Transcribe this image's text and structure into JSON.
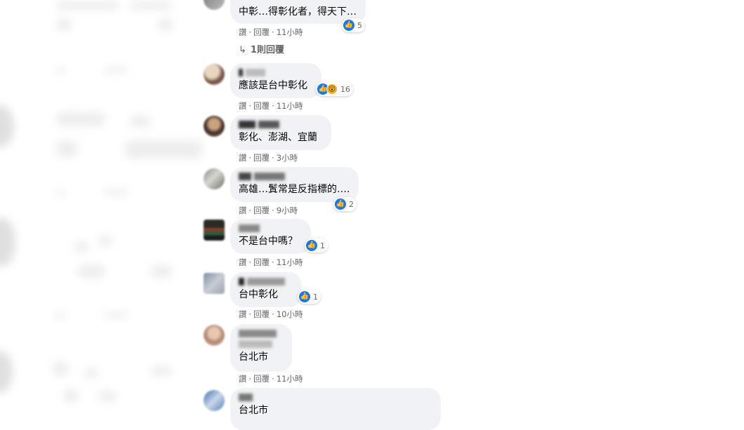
{
  "comments": [
    {
      "id": "c0",
      "text": "中彰…得彰化者，得天下…",
      "like_count": "5",
      "actions": {
        "like": "讚",
        "reply": "回覆",
        "dot": "·",
        "time": "11小時"
      }
    },
    {
      "id": "c1",
      "text": "應該是台中彰化",
      "like_count": "16",
      "actions": {
        "like": "讚",
        "reply": "回覆",
        "dot": "·",
        "time": "11小時"
      }
    },
    {
      "id": "c2",
      "text": "彰化、澎湖、宜蘭",
      "actions": {
        "like": "讚",
        "reply": "回覆",
        "dot": "·",
        "time": "3小時"
      }
    },
    {
      "id": "c3",
      "text": "高雄…鬒常是反指標的….",
      "like_count": "2",
      "actions": {
        "like": "讚",
        "reply": "回覆",
        "dot": "·",
        "time": "9小時"
      }
    },
    {
      "id": "c4",
      "text": "不是台中嗎？",
      "like_count": "1",
      "actions": {
        "like": "讚",
        "reply": "回覆",
        "dot": "·",
        "time": "11小時"
      }
    },
    {
      "id": "c5",
      "text": "台中彰化",
      "like_count": "1",
      "actions": {
        "like": "讚",
        "reply": "回覆",
        "dot": "·",
        "time": "10小時"
      }
    },
    {
      "id": "c6",
      "text": "台北市",
      "actions": {
        "like": "讚",
        "reply": "回覆",
        "dot": "·",
        "time": "11小時"
      }
    },
    {
      "id": "c7",
      "text": "台北市"
    }
  ],
  "replies_link": {
    "arrow": "↳",
    "label": "1則回覆"
  },
  "icons": {
    "like": "like-icon",
    "wow": "wow-icon"
  },
  "colors": {
    "like_blue": "#1877f2",
    "bubble_bg": "#f0f2f5",
    "meta_gray": "#65676b"
  }
}
